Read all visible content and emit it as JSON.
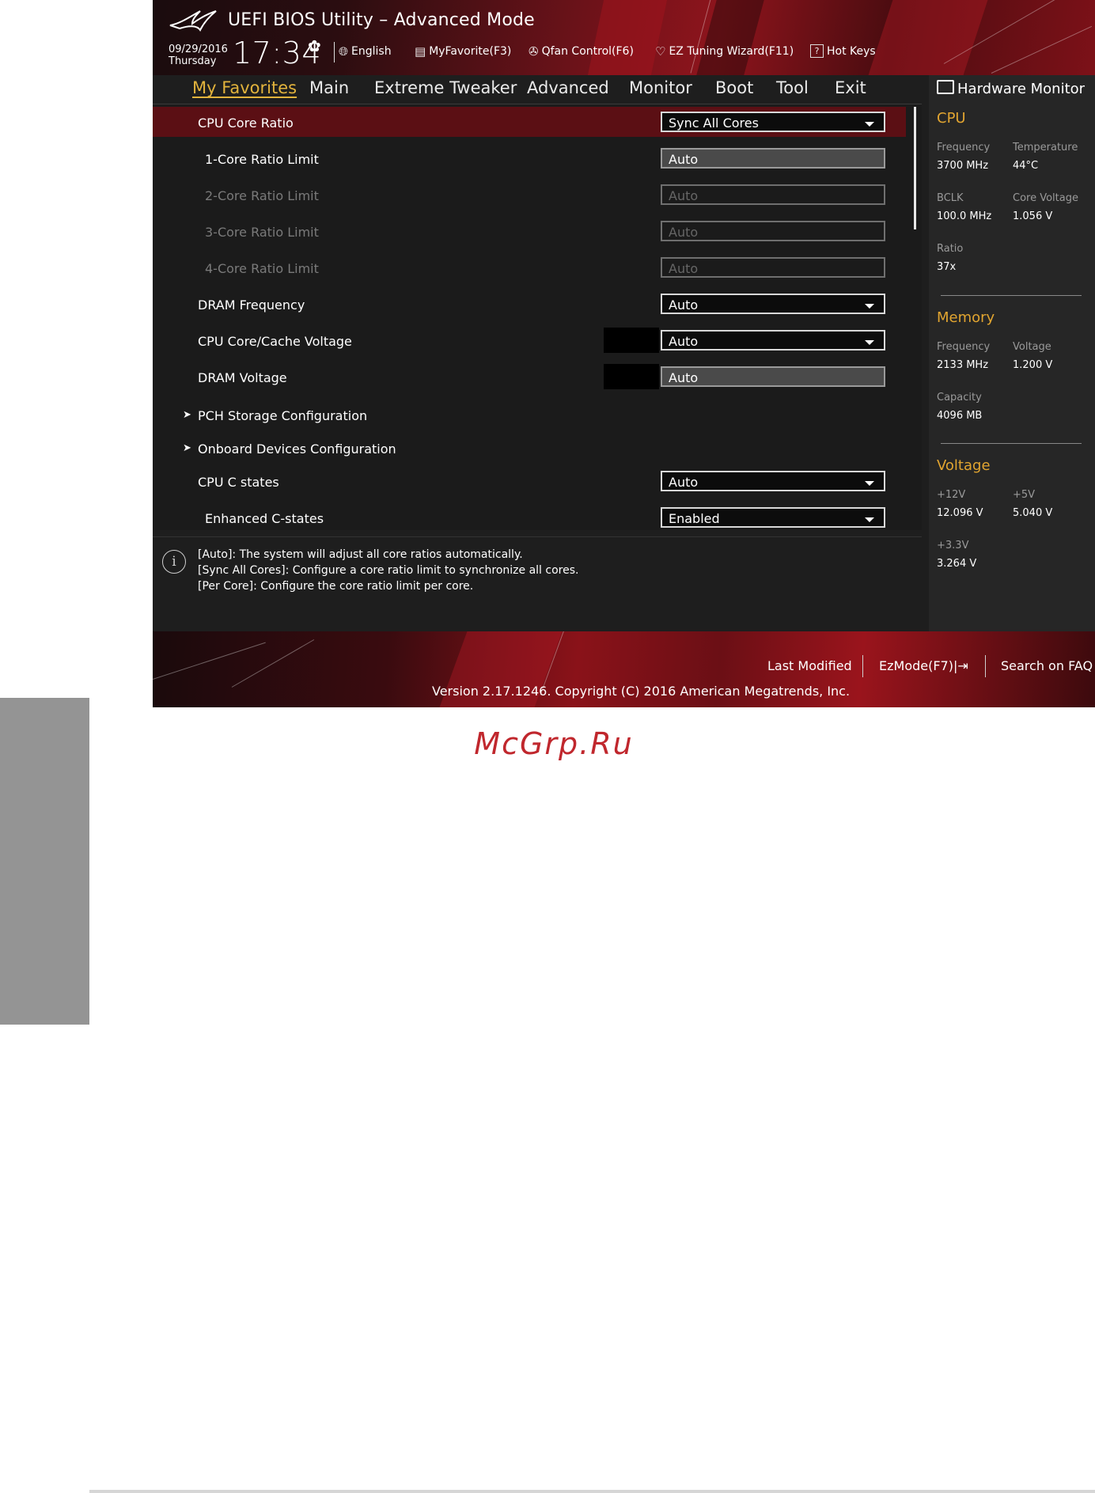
{
  "header": {
    "title": "UEFI BIOS Utility – Advanced Mode",
    "date": "09/29/2016",
    "day": "Thursday",
    "time": "17:34",
    "tools": [
      {
        "label": "English",
        "icon": "globe-icon"
      },
      {
        "label": "MyFavorite(F3)",
        "icon": "favorite-list-icon"
      },
      {
        "label": "Qfan Control(F6)",
        "icon": "fan-icon"
      },
      {
        "label": "EZ Tuning Wizard(F11)",
        "icon": "lightbulb-icon"
      },
      {
        "label": "Hot Keys",
        "icon": "question-box-icon"
      }
    ]
  },
  "menu": {
    "tabs": [
      "My Favorites",
      "Main",
      "Extreme Tweaker",
      "Advanced",
      "Monitor",
      "Boot",
      "Tool",
      "Exit"
    ],
    "active": "My Favorites"
  },
  "settings": [
    {
      "label": "CPU Core Ratio",
      "value": "Sync All Cores",
      "control": "select",
      "selected": true
    },
    {
      "label": "1-Core Ratio Limit",
      "value": "Auto",
      "control": "field"
    },
    {
      "label": "2-Core Ratio Limit",
      "value": "Auto",
      "control": "field",
      "disabled": true
    },
    {
      "label": "3-Core Ratio Limit",
      "value": "Auto",
      "control": "field",
      "disabled": true
    },
    {
      "label": "4-Core Ratio Limit",
      "value": "Auto",
      "control": "field",
      "disabled": true
    },
    {
      "label": "DRAM Frequency",
      "value": "Auto",
      "control": "select"
    },
    {
      "label": "CPU Core/Cache Voltage",
      "value": "Auto",
      "control": "select"
    },
    {
      "label": "DRAM Voltage",
      "value": "Auto",
      "control": "field"
    },
    {
      "label": "PCH Storage Configuration",
      "control": "submenu"
    },
    {
      "label": "Onboard Devices Configuration",
      "control": "submenu"
    },
    {
      "label": "CPU C states",
      "value": "Auto",
      "control": "select"
    },
    {
      "label": "Enhanced C-states",
      "value": "Enabled",
      "control": "select"
    }
  ],
  "help": {
    "lines": [
      "[Auto]: The system will adjust all core ratios automatically.",
      "[Sync All Cores]: Configure a core ratio limit to synchronize all cores.",
      "[Per Core]: Configure the core ratio limit per core."
    ]
  },
  "hardware_monitor": {
    "title": "Hardware Monitor",
    "cpu": {
      "heading": "CPU",
      "frequency_label": "Frequency",
      "frequency": "3700 MHz",
      "temperature_label": "Temperature",
      "temperature": "44°C",
      "bclk_label": "BCLK",
      "bclk": "100.0 MHz",
      "core_voltage_label": "Core Voltage",
      "core_voltage": "1.056 V",
      "ratio_label": "Ratio",
      "ratio": "37x"
    },
    "memory": {
      "heading": "Memory",
      "frequency_label": "Frequency",
      "frequency": "2133 MHz",
      "voltage_label": "Voltage",
      "voltage": "1.200 V",
      "capacity_label": "Capacity",
      "capacity": "4096 MB"
    },
    "voltage": {
      "heading": "Voltage",
      "v12_label": "+12V",
      "v12": "12.096 V",
      "v5_label": "+5V",
      "v5": "5.040 V",
      "v33_label": "+3.3V",
      "v33": "3.264 V"
    }
  },
  "footer": {
    "last_modified": "Last Modified",
    "ezmode": "EzMode(F7)|",
    "search": "Search on FAQ",
    "version": "Version 2.17.1246. Copyright (C) 2016 American Megatrends, Inc."
  },
  "watermark": "McGrp.Ru",
  "colors": {
    "accent": "#e2b33c",
    "selected_row": "#5b0f14",
    "brand_red": "#8e141c",
    "watermark": "#c0272d"
  }
}
